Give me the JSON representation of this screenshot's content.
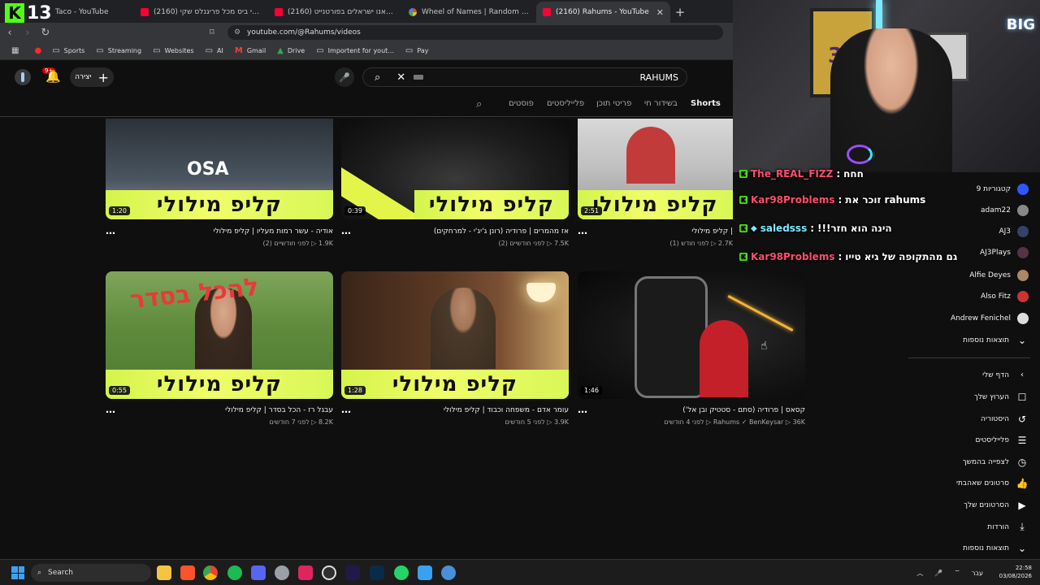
{
  "overlay": {
    "kick_count": "13",
    "big_logo": "BIG"
  },
  "tabs": [
    {
      "label": "Taco - YouTube",
      "type": "yt"
    },
    {
      "label": "(2160) לקחתי ביס מכל פריגנלס שקי",
      "type": "yt"
    },
    {
      "label": "(2160) מצאנו ישראלים בפורטנייט - ...",
      "type": "yt"
    },
    {
      "label": "Wheel of Names | Random name pic",
      "type": "g"
    },
    {
      "label": "(2160) Rahums - YouTube",
      "type": "yt",
      "active": true
    }
  ],
  "address": {
    "url": "youtube.com/@Rahums/videos"
  },
  "bookmarks": [
    "Sports",
    "Streaming",
    "Websites",
    "AI",
    "Gmail",
    "Drive",
    "Importent for yout...",
    "Pay"
  ],
  "header": {
    "notif_count": "9+",
    "create_label": "יצירה",
    "search_value": "RAHUMS"
  },
  "channel_tabs": {
    "posts": "פוסטים",
    "playlists": "פלייליסטים",
    "podcasts": "פריטי תוכן",
    "live": "בשידור חי",
    "shorts": "Shorts"
  },
  "videos": [
    {
      "title": "אודיה - עשר רמות מעליו | קליפ מילולי",
      "meta": "1.9K ▷  לפני חודשיים (2)",
      "duration": "1:20",
      "banner": "קליפ מילולי"
    },
    {
      "title": "אז מהמרים | פרודיה (רונן ג'יג'י - למרחקים)",
      "meta": "7.5K ▷  לפני חודשיים (2)",
      "duration": "0:39",
      "banner": "קליפ מילולי"
    },
    {
      "title": "| קליפ מילולי",
      "meta": "2.7K ▷  לפני חודש (1)",
      "duration": "2:51",
      "banner": "קליפ מילולי"
    },
    {
      "title": "עבגל רז - הכל בסדר | קליפ מילולי",
      "meta": "8.2K ▷  לפני 7 חודשים",
      "duration": "0:55",
      "banner": "קליפ מילולי"
    },
    {
      "title": "עומר אדם - משפחה וכבוד | קליפ מילולי",
      "meta": "3.9K ▷  לפני 5 חודשים",
      "duration": "1:28",
      "banner": "קליפ מילולי"
    },
    {
      "title": "קסאס | פרודיה (סתם - סטטיק ובן אל')",
      "meta": "Rahums ✓ BenKeysar ▷ 36K ▷  לפני 4 חודשים",
      "duration": "1:46",
      "banner": ""
    }
  ],
  "sidebar": {
    "subs": [
      {
        "label": "9 קטגוריות",
        "color": "#3355ff"
      },
      {
        "label": "adam22",
        "color": "#888888"
      },
      {
        "label": "AJ3",
        "color": "#334466"
      },
      {
        "label": "AJ3Plays",
        "color": "#553344"
      },
      {
        "label": "Alfie Deyes",
        "color": "#aa8866"
      },
      {
        "label": "Also Fitz",
        "color": "#cc3333"
      },
      {
        "label": "Andrew Fenichel",
        "color": "#dddddd"
      }
    ],
    "show_more": "תוצאות נוספות",
    "you_header": "הדף שלי",
    "you_items": [
      {
        "label": "הערוץ שלך",
        "icon": "☐"
      },
      {
        "label": "היסטוריה",
        "icon": "↺"
      },
      {
        "label": "פלייליסטים",
        "icon": "☰"
      },
      {
        "label": "לצפייה בהמשך",
        "icon": "◷"
      },
      {
        "label": "סרטונים שאהבתי",
        "icon": "👍"
      },
      {
        "label": "הסרטונים שלך",
        "icon": "▶"
      },
      {
        "label": "הורדות",
        "icon": "⤓"
      },
      {
        "label": "תוצאות נוספות",
        "icon": "⌄"
      }
    ]
  },
  "chat": [
    {
      "user": "The_REAL_FIZZ",
      "text": "חחח",
      "color": "#ff4d6d"
    },
    {
      "user": "Kar98Problems",
      "text": "זוכר את rahums",
      "color": "#ff4d6d"
    },
    {
      "user": "saledsss",
      "text": "!!!הינה הוא חזר",
      "color": "#7fe9ff"
    },
    {
      "user": "Kar98Problems",
      "text": "גם מהתקופה של גיא טייו",
      "color": "#ff4d6d"
    }
  ],
  "taskbar": {
    "search_label": "Search",
    "lang": "עבר",
    "time": "22:58",
    "date": "03/08/2026"
  }
}
